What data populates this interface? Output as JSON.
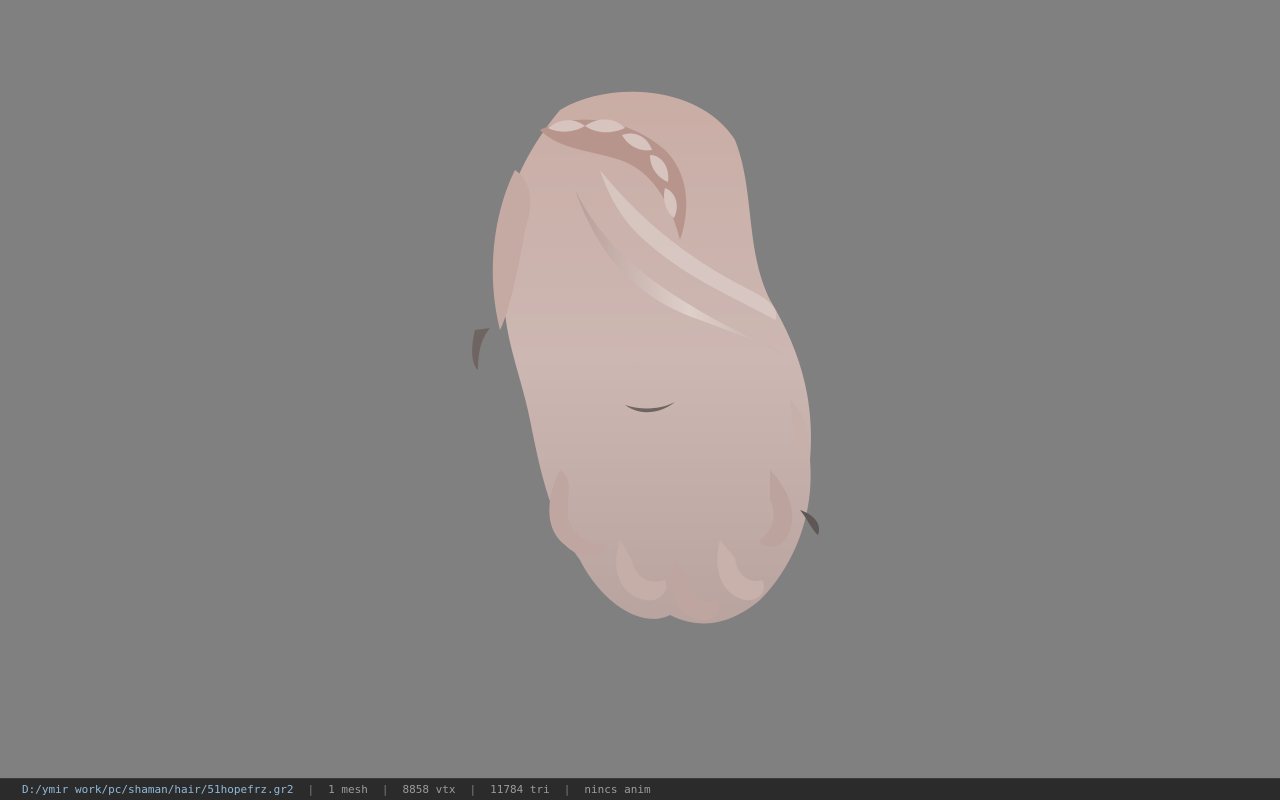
{
  "viewport": {
    "background": "#808080",
    "model_icon": "hair-mesh-icon"
  },
  "statusbar": {
    "path": "D:/ymir work/pc/shaman/hair/51hopefrz.gr2",
    "separator": "|",
    "mesh": "1 mesh",
    "vtx": "8858 vtx",
    "tri": "11784 tri",
    "anim": "nincs anim"
  }
}
